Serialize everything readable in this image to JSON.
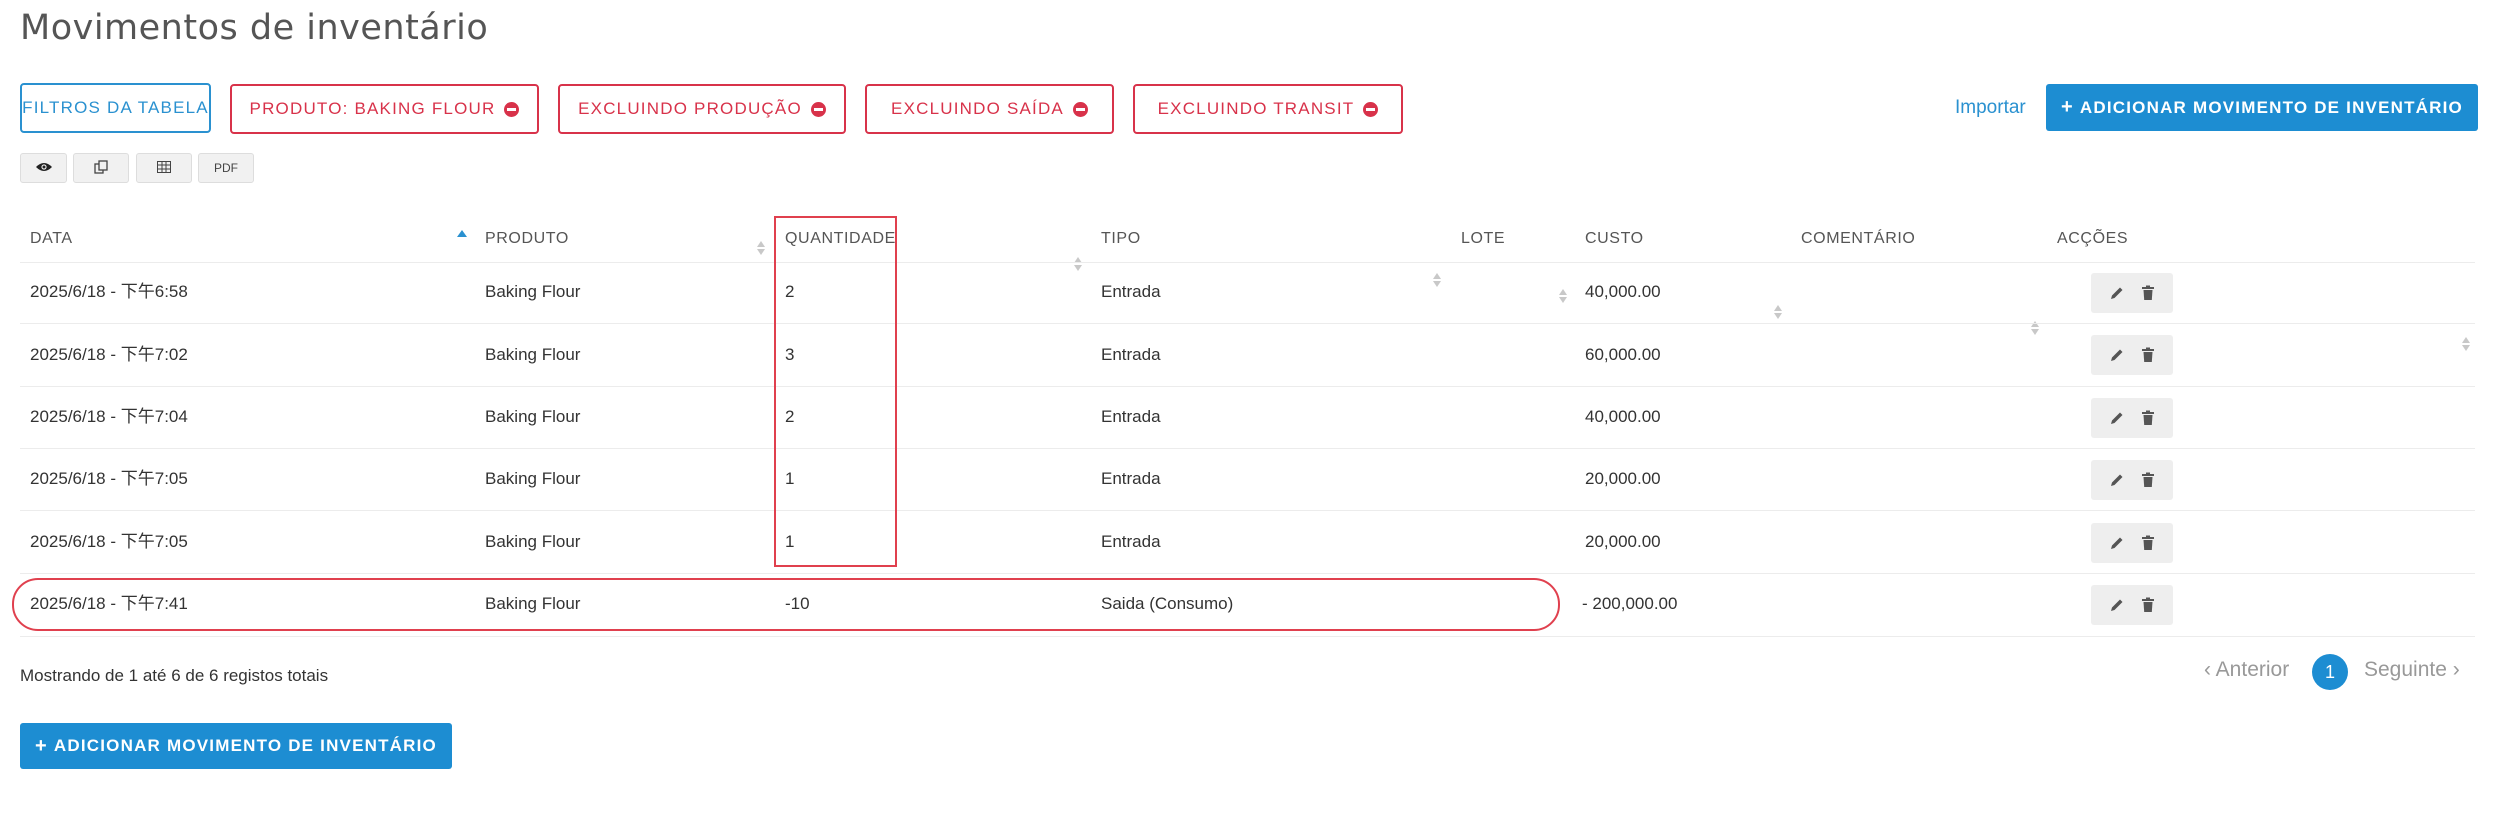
{
  "page": {
    "title": "Movimentos de inventário"
  },
  "filters": {
    "table_filters": "FILTROS DA TABELA",
    "chips": [
      "PRODUTO: BAKING FLOUR",
      "EXCLUINDO PRODUÇÃO",
      "EXCLUINDO SAÍDA",
      "EXCLUINDO TRANSIT"
    ]
  },
  "toolbar": {
    "import_label": "Importar",
    "add_label": "ADICIONAR MOVIMENTO DE INVENTÁRIO",
    "pdf_label": "PDF"
  },
  "table": {
    "headers": [
      "DATA",
      "PRODUTO",
      "QUANTIDADE",
      "TIPO",
      "LOTE",
      "CUSTO",
      "COMENTÁRIO",
      "ACÇÕES"
    ],
    "rows": [
      {
        "date": "2025/6/18 - 下午6:58",
        "product": "Baking Flour",
        "qty": "2",
        "type": "Entrada",
        "lot": "",
        "cost": "40,000.00",
        "comment": ""
      },
      {
        "date": "2025/6/18 - 下午7:02",
        "product": "Baking Flour",
        "qty": "3",
        "type": "Entrada",
        "lot": "",
        "cost": "60,000.00",
        "comment": ""
      },
      {
        "date": "2025/6/18 - 下午7:04",
        "product": "Baking Flour",
        "qty": "2",
        "type": "Entrada",
        "lot": "",
        "cost": "40,000.00",
        "comment": ""
      },
      {
        "date": "2025/6/18 - 下午7:05",
        "product": "Baking Flour",
        "qty": "1",
        "type": "Entrada",
        "lot": "",
        "cost": "20,000.00",
        "comment": ""
      },
      {
        "date": "2025/6/18 - 下午7:05",
        "product": "Baking Flour",
        "qty": "1",
        "type": "Entrada",
        "lot": "",
        "cost": "20,000.00",
        "comment": ""
      },
      {
        "date": "2025/6/18 - 下午7:41",
        "product": "Baking Flour",
        "qty": "-10",
        "type": "Saida (Consumo)",
        "lot": "",
        "cost": "- 200,000.00",
        "comment": ""
      }
    ]
  },
  "footer": {
    "info": "Mostrando de 1 até 6 de 6 registos totais",
    "add_label": "ADICIONAR MOVIMENTO DE INVENTÁRIO"
  },
  "pagination": {
    "prev": "‹ Anterior",
    "current": "1",
    "next": "Seguinte ›"
  },
  "colors": {
    "primary": "#1d8dd2",
    "danger": "#d8324a",
    "highlight": "#e0404e"
  },
  "icons": [
    "eye-icon",
    "copy-icon",
    "table-icon",
    "pencil-icon",
    "trash-icon",
    "minus-circle-icon",
    "plus-icon",
    "sort-icon"
  ]
}
